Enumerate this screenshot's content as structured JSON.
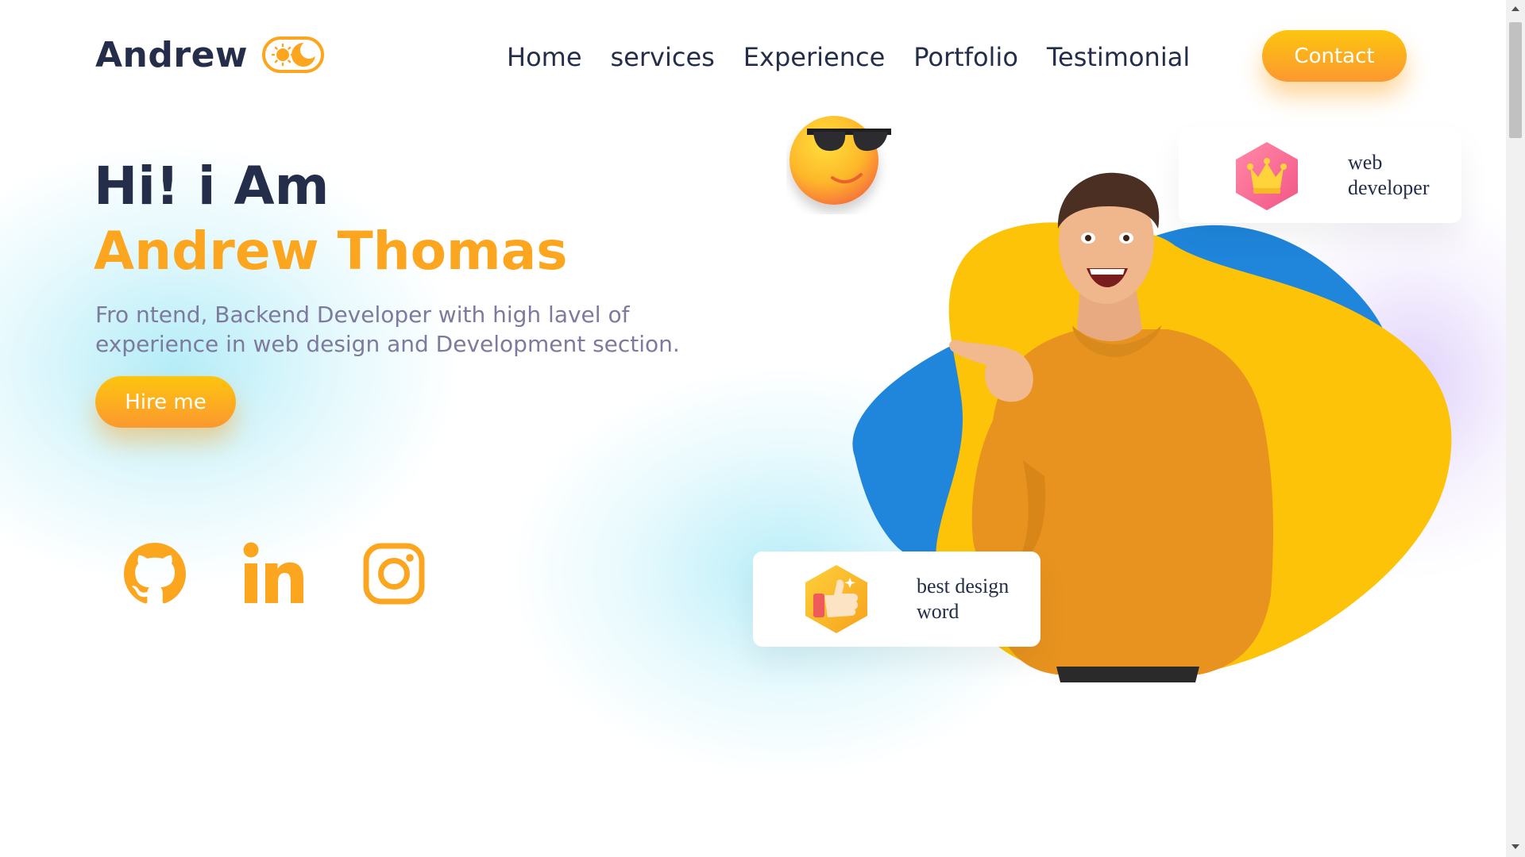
{
  "nav": {
    "brand": "Andrew",
    "theme_toggle_icon": "sun-moon-toggle-icon",
    "items": [
      {
        "label": "Home"
      },
      {
        "label": "services"
      },
      {
        "label": "Experience"
      },
      {
        "label": "Portfolio"
      },
      {
        "label": "Testimonial"
      }
    ],
    "contact_label": "Contact"
  },
  "hero": {
    "greeting": "Hi! i Am",
    "name": "Andrew Thomas",
    "description": "Fro ntend, Backend Developer with high lavel of experience in web design and Development section.",
    "hire_label": "Hire me",
    "socials": [
      {
        "icon": "github-icon"
      },
      {
        "icon": "linkedin-icon"
      },
      {
        "icon": "instagram-icon"
      }
    ]
  },
  "floating_cards": {
    "web": {
      "icon": "crown-icon",
      "line1": "web",
      "line2": "developer"
    },
    "design": {
      "icon": "thumbs-up-icon",
      "line1": "best design",
      "line2": "word"
    }
  },
  "decorations": {
    "emoji": "sunglasses-emoji-icon"
  },
  "colors": {
    "accent": "#fca61f",
    "accent_light": "#fdc50f",
    "text_dark": "#242d49",
    "text_muted": "#7d7a9d",
    "blob_blue": "#1f86dc",
    "blob_yellow": "#fcc308"
  }
}
